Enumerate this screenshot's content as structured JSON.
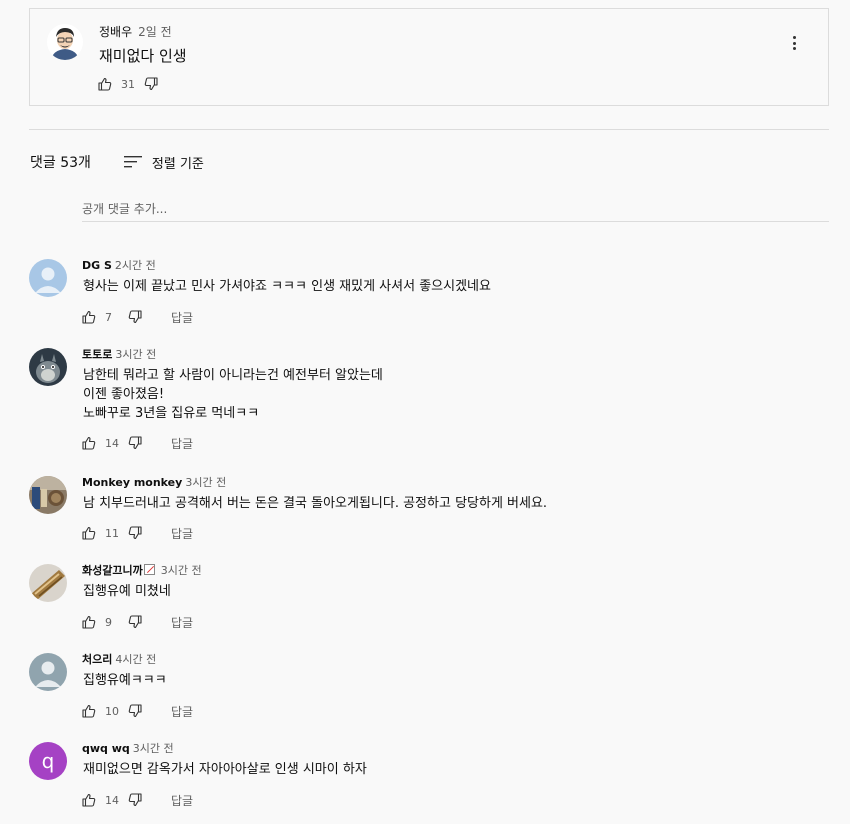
{
  "pinned": {
    "author": "정배우",
    "timestamp": "2일 전",
    "text": "재미없다 인생",
    "likes": "31",
    "avatar_icon": "cartoon-man-avatar"
  },
  "header": {
    "count_label": "댓글 53개",
    "sort_label": "정렬 기준"
  },
  "add_comment": {
    "placeholder": "공개 댓글 추가..."
  },
  "comments": [
    {
      "author": "DG S",
      "timestamp": "2시간 전",
      "lines": [
        "형사는 이제 끝났고 민사 가셔야죠 ㅋㅋㅋ 인생 재밌게 사셔서 좋으시겠네요"
      ],
      "likes": "7",
      "reply": "답글",
      "avatar": "default-person-avatar"
    },
    {
      "author": "토토로",
      "timestamp": "3시간 전",
      "lines": [
        "남한테 뭐라고 할 사람이 아니라는건 예전부터 알았는데",
        "이젠 좋아졌음!",
        "노빠꾸로 3년을 집유로 먹네ㅋㅋ"
      ],
      "likes": "14",
      "reply": "답글",
      "avatar": "totoro-avatar"
    },
    {
      "author": "Monkey monkey",
      "timestamp": "3시간 전",
      "lines": [
        "남 치부드러내고 공격해서 버는 돈은 결국 돌아오게됩니다. 공정하고 당당하게 버세요."
      ],
      "likes": "11",
      "reply": "답글",
      "avatar": "photo-avatar"
    },
    {
      "author": "화성갈끄니까",
      "timestamp": "3시간 전",
      "lines": [
        "집행유예 미쳤네"
      ],
      "likes": "9",
      "reply": "답글",
      "avatar": "photo-avatar"
    },
    {
      "author": "처으리",
      "timestamp": "4시간 전",
      "lines": [
        "집행유예ㅋㅋㅋ"
      ],
      "likes": "10",
      "reply": "답글",
      "avatar": "default-person-avatar"
    },
    {
      "author": "qwq wq",
      "timestamp": "3시간 전",
      "lines": [
        "재미없으면 감옥가서 자아아아살로 인생 시마이 하자"
      ],
      "likes": "14",
      "reply": "답글",
      "avatar": "letter-avatar",
      "avatar_letter": "q"
    }
  ],
  "colors": {
    "letter_avatar_bg": "#a542c4",
    "text_secondary": "#606060"
  }
}
